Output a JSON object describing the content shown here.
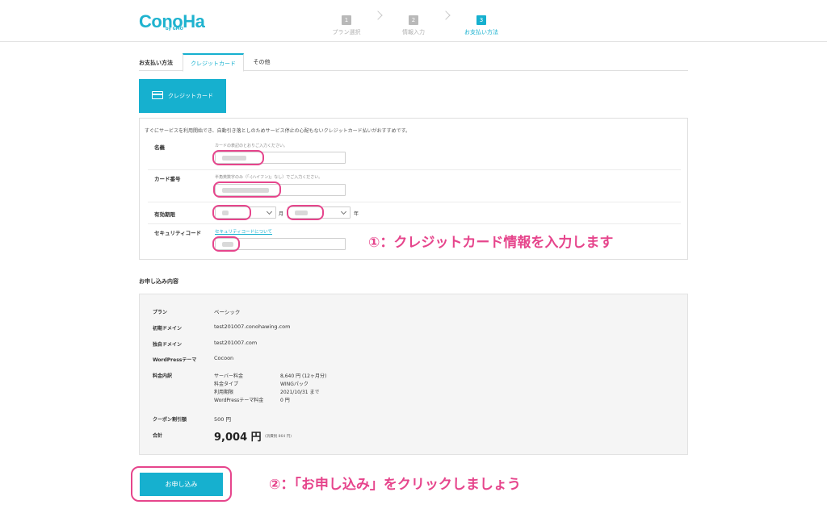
{
  "header": {
    "logo": "ConoHa",
    "logo_sub": "by GMO",
    "steps": [
      {
        "num": "1",
        "label": "プラン選択"
      },
      {
        "num": "2",
        "label": "情報入力"
      },
      {
        "num": "3",
        "label": "お支払い方法"
      }
    ]
  },
  "tabs": {
    "label": "お支払い方法",
    "items": [
      {
        "label": "クレジットカード"
      },
      {
        "label": "その他"
      }
    ]
  },
  "card": {
    "header_label": "クレジットカード",
    "intro": "すぐにサービスを利用開始でき、自動引き落としのためサービス停止の心配もないクレジットカード払いがおすすめです。",
    "name_label": "名義",
    "name_hint": "カードの表記のとおりご入力ください。",
    "number_label": "カード番号",
    "number_hint": "半角英数字のみ（「-(ハイフン)」なし）でご入力ください。",
    "expiry_label": "有効期限",
    "month_unit": "月",
    "year_unit": "年",
    "security_label": "セキュリティコード",
    "security_link": "セキュリティコードについて"
  },
  "annotations": {
    "first": "①：クレジットカード情報を入力します",
    "second": "②：「お申し込み」をクリックしましょう"
  },
  "summary": {
    "title": "お申し込み内容",
    "plan_label": "プラン",
    "plan_value": "ベーシック",
    "initial_domain_label": "初期ドメイン",
    "initial_domain_value": "test201007.conohawing.com",
    "own_domain_label": "独自ドメイン",
    "own_domain_value": "test201007.com",
    "theme_label": "WordPressテーマ",
    "theme_value": "Cocoon",
    "fee_label": "料金内訳",
    "fees": [
      {
        "name": "サーバー料金",
        "value": "8,640 円 (12ヶ月分)"
      },
      {
        "name": "料金タイプ",
        "value": "WINGパック"
      },
      {
        "name": "利用期限",
        "value": "2021/10/31 まで"
      },
      {
        "name": "WordPressテーマ料金",
        "value": "0 円"
      }
    ],
    "coupon_label": "クーポン割引額",
    "coupon_value": "500 円",
    "total_label": "合計",
    "total_value": "9,004 円",
    "total_note": "(消費税 864 円)"
  },
  "submit": {
    "label": "お申し込み"
  },
  "colors": {
    "accent": "#16b0cf",
    "highlight": "#e6458c"
  }
}
